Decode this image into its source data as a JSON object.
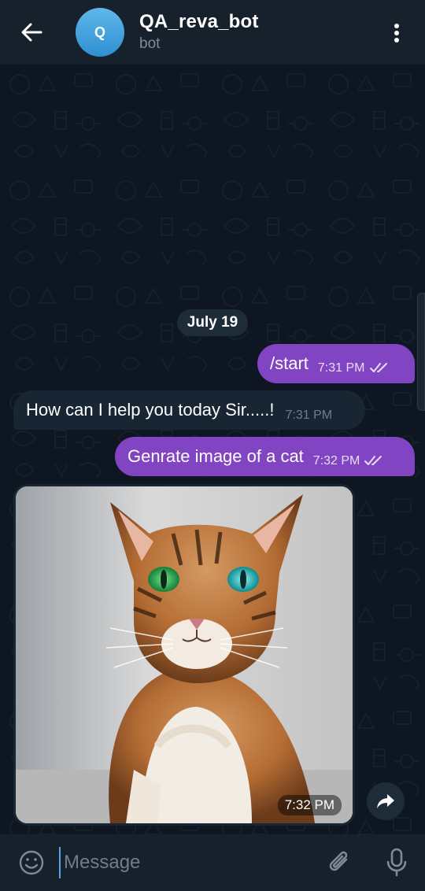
{
  "header": {
    "avatar_letter": "Q",
    "title": "QA_reva_bot",
    "subtitle": "bot"
  },
  "chat": {
    "date": "July 19",
    "messages": [
      {
        "direction": "out",
        "text": "/start",
        "time": "7:31 PM",
        "status": "read"
      },
      {
        "direction": "in",
        "text": "How can I help you today Sir.....!",
        "time": "7:31 PM"
      },
      {
        "direction": "out",
        "text": "Genrate image of a cat",
        "time": "7:32 PM",
        "status": "read"
      },
      {
        "direction": "in",
        "type": "photo",
        "description": "tabby cat with green and blue eyes",
        "time": "7:32 PM"
      }
    ]
  },
  "input": {
    "placeholder": "Message",
    "value": ""
  },
  "colors": {
    "header_bg": "#17212b",
    "chat_bg": "#0e1621",
    "outgoing_bubble": "#8144c2",
    "incoming_bubble": "#182533",
    "accent": "#5aa0ea"
  }
}
